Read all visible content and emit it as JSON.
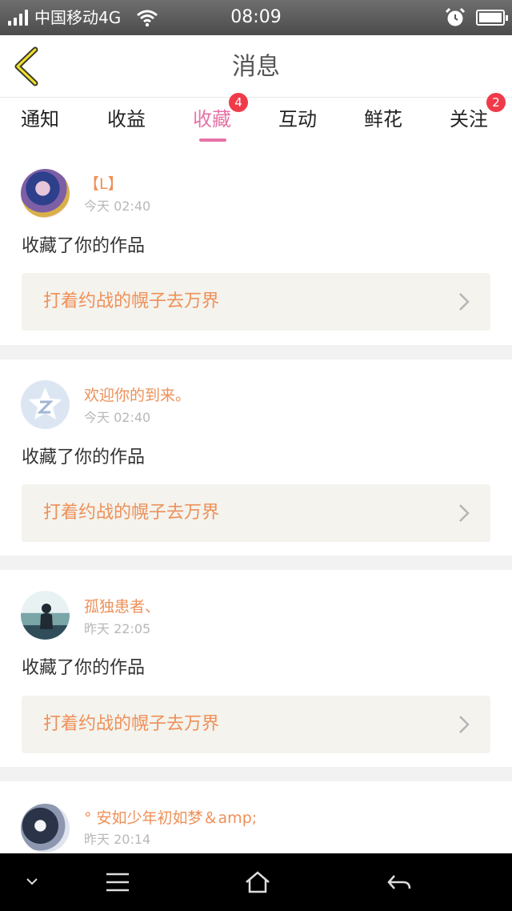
{
  "status_bar": {
    "carrier": "中国移动4G",
    "time": "08:09"
  },
  "header": {
    "title": "消息"
  },
  "tabs": [
    {
      "label": "通知",
      "badge": ""
    },
    {
      "label": "收益",
      "badge": ""
    },
    {
      "label": "收藏",
      "badge": "4",
      "active": true
    },
    {
      "label": "互动",
      "badge": ""
    },
    {
      "label": "鲜花",
      "badge": ""
    },
    {
      "label": "关注",
      "badge": "2"
    }
  ],
  "colors": {
    "accent": "#e673a7",
    "name_orange": "#ee9058",
    "badge_red": "#f03a4a"
  },
  "feed": [
    {
      "user": "【L】",
      "time": "今天 02:40",
      "action": "收藏了你的作品",
      "work_title": "打着约战的幌子去万界"
    },
    {
      "user": "欢迎你的到来。",
      "time": "今天 02:40",
      "action": "收藏了你的作品",
      "work_title": "打着约战的幌子去万界"
    },
    {
      "user": "孤独患者、",
      "time": "昨天 22:05",
      "action": "收藏了你的作品",
      "work_title": "打着约战的幌子去万界"
    },
    {
      "user": "° 安如少年初如梦＆amp;",
      "time": "昨天 20:14"
    }
  ],
  "icons": {
    "back": "chevron-left-icon",
    "work_arrow": "chevron-right-icon",
    "nav": [
      "chevron-down-icon",
      "menu-icon",
      "home-icon",
      "back-arrow-icon"
    ]
  }
}
